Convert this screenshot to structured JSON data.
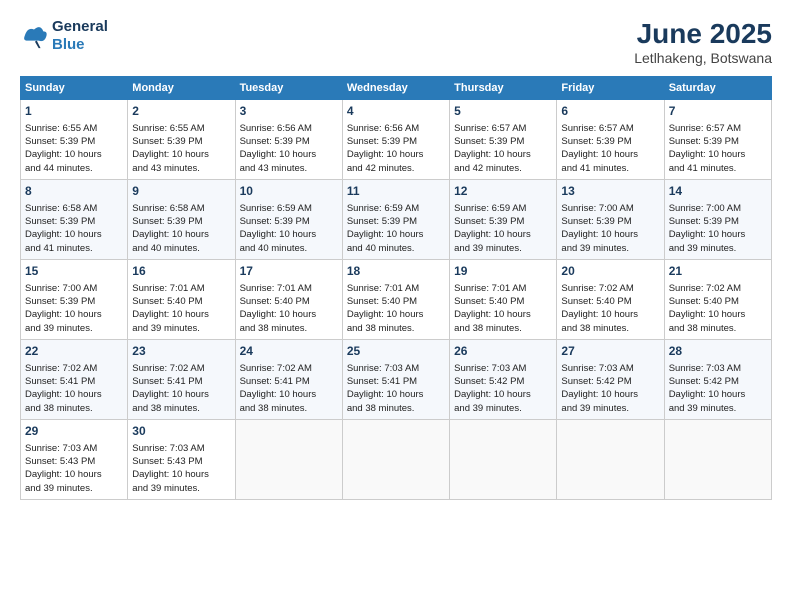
{
  "header": {
    "logo_line1": "General",
    "logo_line2": "Blue",
    "main_title": "June 2025",
    "subtitle": "Letlhakeng, Botswana"
  },
  "weekdays": [
    "Sunday",
    "Monday",
    "Tuesday",
    "Wednesday",
    "Thursday",
    "Friday",
    "Saturday"
  ],
  "weeks": [
    [
      {
        "day": 1,
        "lines": [
          "Sunrise: 6:55 AM",
          "Sunset: 5:39 PM",
          "Daylight: 10 hours",
          "and 44 minutes."
        ]
      },
      {
        "day": 2,
        "lines": [
          "Sunrise: 6:55 AM",
          "Sunset: 5:39 PM",
          "Daylight: 10 hours",
          "and 43 minutes."
        ]
      },
      {
        "day": 3,
        "lines": [
          "Sunrise: 6:56 AM",
          "Sunset: 5:39 PM",
          "Daylight: 10 hours",
          "and 43 minutes."
        ]
      },
      {
        "day": 4,
        "lines": [
          "Sunrise: 6:56 AM",
          "Sunset: 5:39 PM",
          "Daylight: 10 hours",
          "and 42 minutes."
        ]
      },
      {
        "day": 5,
        "lines": [
          "Sunrise: 6:57 AM",
          "Sunset: 5:39 PM",
          "Daylight: 10 hours",
          "and 42 minutes."
        ]
      },
      {
        "day": 6,
        "lines": [
          "Sunrise: 6:57 AM",
          "Sunset: 5:39 PM",
          "Daylight: 10 hours",
          "and 41 minutes."
        ]
      },
      {
        "day": 7,
        "lines": [
          "Sunrise: 6:57 AM",
          "Sunset: 5:39 PM",
          "Daylight: 10 hours",
          "and 41 minutes."
        ]
      }
    ],
    [
      {
        "day": 8,
        "lines": [
          "Sunrise: 6:58 AM",
          "Sunset: 5:39 PM",
          "Daylight: 10 hours",
          "and 41 minutes."
        ]
      },
      {
        "day": 9,
        "lines": [
          "Sunrise: 6:58 AM",
          "Sunset: 5:39 PM",
          "Daylight: 10 hours",
          "and 40 minutes."
        ]
      },
      {
        "day": 10,
        "lines": [
          "Sunrise: 6:59 AM",
          "Sunset: 5:39 PM",
          "Daylight: 10 hours",
          "and 40 minutes."
        ]
      },
      {
        "day": 11,
        "lines": [
          "Sunrise: 6:59 AM",
          "Sunset: 5:39 PM",
          "Daylight: 10 hours",
          "and 40 minutes."
        ]
      },
      {
        "day": 12,
        "lines": [
          "Sunrise: 6:59 AM",
          "Sunset: 5:39 PM",
          "Daylight: 10 hours",
          "and 39 minutes."
        ]
      },
      {
        "day": 13,
        "lines": [
          "Sunrise: 7:00 AM",
          "Sunset: 5:39 PM",
          "Daylight: 10 hours",
          "and 39 minutes."
        ]
      },
      {
        "day": 14,
        "lines": [
          "Sunrise: 7:00 AM",
          "Sunset: 5:39 PM",
          "Daylight: 10 hours",
          "and 39 minutes."
        ]
      }
    ],
    [
      {
        "day": 15,
        "lines": [
          "Sunrise: 7:00 AM",
          "Sunset: 5:39 PM",
          "Daylight: 10 hours",
          "and 39 minutes."
        ]
      },
      {
        "day": 16,
        "lines": [
          "Sunrise: 7:01 AM",
          "Sunset: 5:40 PM",
          "Daylight: 10 hours",
          "and 39 minutes."
        ]
      },
      {
        "day": 17,
        "lines": [
          "Sunrise: 7:01 AM",
          "Sunset: 5:40 PM",
          "Daylight: 10 hours",
          "and 38 minutes."
        ]
      },
      {
        "day": 18,
        "lines": [
          "Sunrise: 7:01 AM",
          "Sunset: 5:40 PM",
          "Daylight: 10 hours",
          "and 38 minutes."
        ]
      },
      {
        "day": 19,
        "lines": [
          "Sunrise: 7:01 AM",
          "Sunset: 5:40 PM",
          "Daylight: 10 hours",
          "and 38 minutes."
        ]
      },
      {
        "day": 20,
        "lines": [
          "Sunrise: 7:02 AM",
          "Sunset: 5:40 PM",
          "Daylight: 10 hours",
          "and 38 minutes."
        ]
      },
      {
        "day": 21,
        "lines": [
          "Sunrise: 7:02 AM",
          "Sunset: 5:40 PM",
          "Daylight: 10 hours",
          "and 38 minutes."
        ]
      }
    ],
    [
      {
        "day": 22,
        "lines": [
          "Sunrise: 7:02 AM",
          "Sunset: 5:41 PM",
          "Daylight: 10 hours",
          "and 38 minutes."
        ]
      },
      {
        "day": 23,
        "lines": [
          "Sunrise: 7:02 AM",
          "Sunset: 5:41 PM",
          "Daylight: 10 hours",
          "and 38 minutes."
        ]
      },
      {
        "day": 24,
        "lines": [
          "Sunrise: 7:02 AM",
          "Sunset: 5:41 PM",
          "Daylight: 10 hours",
          "and 38 minutes."
        ]
      },
      {
        "day": 25,
        "lines": [
          "Sunrise: 7:03 AM",
          "Sunset: 5:41 PM",
          "Daylight: 10 hours",
          "and 38 minutes."
        ]
      },
      {
        "day": 26,
        "lines": [
          "Sunrise: 7:03 AM",
          "Sunset: 5:42 PM",
          "Daylight: 10 hours",
          "and 39 minutes."
        ]
      },
      {
        "day": 27,
        "lines": [
          "Sunrise: 7:03 AM",
          "Sunset: 5:42 PM",
          "Daylight: 10 hours",
          "and 39 minutes."
        ]
      },
      {
        "day": 28,
        "lines": [
          "Sunrise: 7:03 AM",
          "Sunset: 5:42 PM",
          "Daylight: 10 hours",
          "and 39 minutes."
        ]
      }
    ],
    [
      {
        "day": 29,
        "lines": [
          "Sunrise: 7:03 AM",
          "Sunset: 5:43 PM",
          "Daylight: 10 hours",
          "and 39 minutes."
        ]
      },
      {
        "day": 30,
        "lines": [
          "Sunrise: 7:03 AM",
          "Sunset: 5:43 PM",
          "Daylight: 10 hours",
          "and 39 minutes."
        ]
      },
      {
        "day": null,
        "lines": []
      },
      {
        "day": null,
        "lines": []
      },
      {
        "day": null,
        "lines": []
      },
      {
        "day": null,
        "lines": []
      },
      {
        "day": null,
        "lines": []
      }
    ]
  ]
}
